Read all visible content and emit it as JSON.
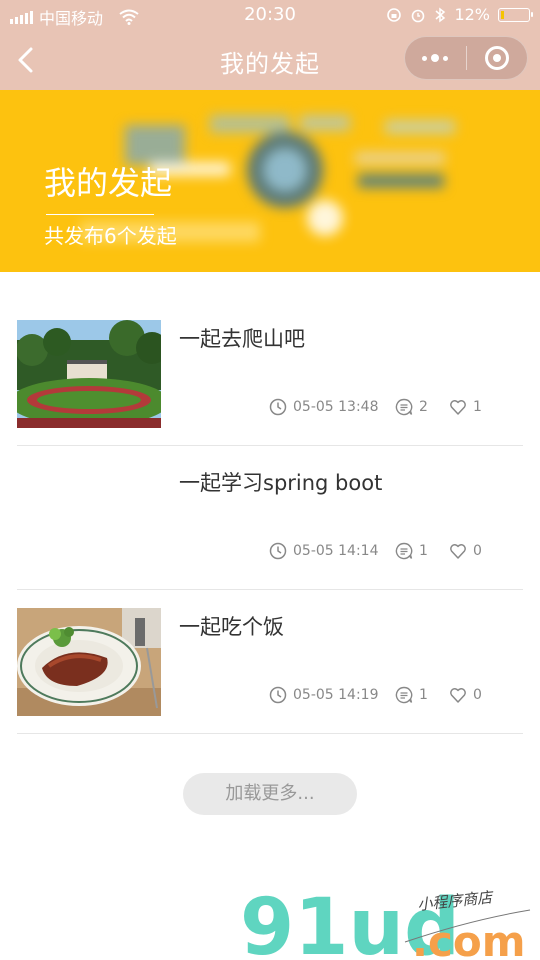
{
  "status_bar": {
    "carrier": "中国移动",
    "time": "20:30",
    "battery": "12%",
    "battery_level": 0.12
  },
  "nav": {
    "title": "我的发起",
    "back_icon": "chevron-left-icon",
    "more_icon": "more-dots-icon",
    "close_icon": "target-close-icon"
  },
  "banner": {
    "title": "我的发起",
    "subtitle": "共发布6个发起"
  },
  "items": [
    {
      "title": "一起去爬山吧",
      "time": "05-05 13:48",
      "comments": "2",
      "likes": "1",
      "has_image": true,
      "image": "park-hill-photo"
    },
    {
      "title": "一起学习spring boot",
      "time": "05-05 14:14",
      "comments": "1",
      "likes": "0",
      "has_image": false
    },
    {
      "title": "一起吃个饭",
      "time": "05-05 14:19",
      "comments": "1",
      "likes": "0",
      "has_image": true,
      "image": "steak-plate-photo"
    }
  ],
  "load_more": "加载更多...",
  "watermark": {
    "logo": "91ud",
    "domain": ".com",
    "tagline": "小程序商店"
  },
  "colors": {
    "nav_bg": "#e8c4b5",
    "banner_bg": "#fdc20f",
    "watermark_teal": "#5fd5c0",
    "watermark_orange": "#f5a04a"
  }
}
